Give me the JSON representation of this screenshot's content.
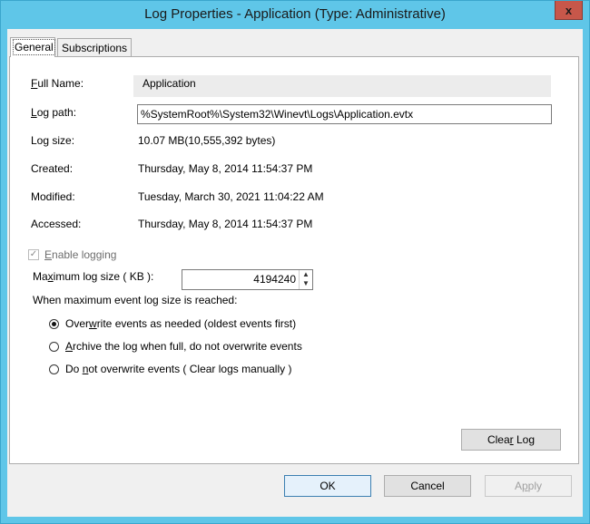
{
  "window": {
    "title": "Log Properties - Application (Type: Administrative)",
    "close_label": "x"
  },
  "tabs": [
    {
      "label": "General",
      "active": true
    },
    {
      "label": "Subscriptions",
      "active": false
    }
  ],
  "general": {
    "full_name_label_u": "F",
    "full_name_label_rest": "ull Name:",
    "full_name_value": "Application",
    "log_path_label_u": "L",
    "log_path_label_rest": "og path:",
    "log_path_value": "%SystemRoot%\\System32\\Winevt\\Logs\\Application.evtx",
    "log_size_label": "Log size:",
    "log_size_value": "10.07 MB(10,555,392 bytes)",
    "created_label": "Created:",
    "created_value": "Thursday, May 8, 2014 11:54:37 PM",
    "modified_label": "Modified:",
    "modified_value": "Tuesday, March 30, 2021 11:04:22 AM",
    "accessed_label": "Accessed:",
    "accessed_value": "Thursday, May 8, 2014 11:54:37 PM",
    "enable_logging_u": "E",
    "enable_logging_rest": "nable logging",
    "enable_logging_checked": true,
    "max_size_label_a": "Ma",
    "max_size_label_u": "x",
    "max_size_label_b": "imum log size ( KB ):",
    "max_size_value": "4194240",
    "when_reached_label": "When maximum event log size is reached:",
    "options": [
      {
        "a": "Over",
        "u": "w",
        "b": "rite events as needed (oldest events first)",
        "selected": true
      },
      {
        "a": "",
        "u": "A",
        "b": "rchive the log when full, do not overwrite events",
        "selected": false
      },
      {
        "a": "Do ",
        "u": "n",
        "b": "ot overwrite events ( Clear logs manually )",
        "selected": false
      }
    ],
    "clear_log_a": "Clea",
    "clear_log_u": "r",
    "clear_log_b": " Log"
  },
  "footer": {
    "ok_label": "OK",
    "cancel_label": "Cancel",
    "apply_a": "A",
    "apply_u": "p",
    "apply_b": "ply"
  }
}
